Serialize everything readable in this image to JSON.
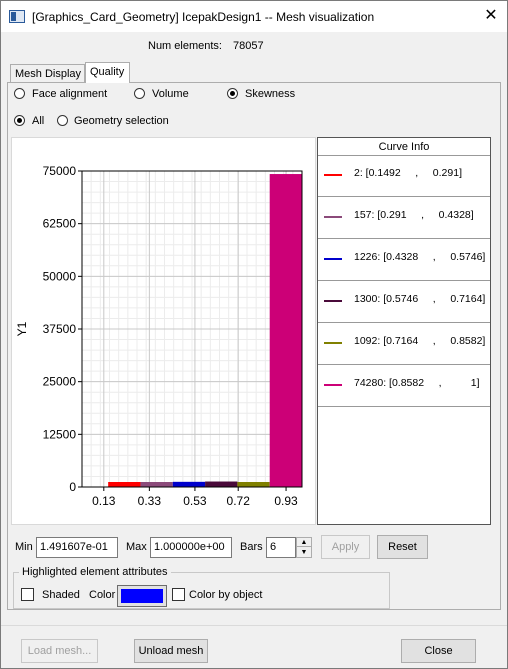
{
  "window": {
    "title": "[Graphics_Card_Geometry] IcepakDesign1 -- Mesh visualization",
    "close_glyph": "✕",
    "app_icon": "window-icon"
  },
  "summary": {
    "num_elements_label": "Num elements:",
    "num_elements_value": "78057"
  },
  "tabs": [
    {
      "label": "Mesh Display",
      "active": false
    },
    {
      "label": "Quality",
      "active": true
    }
  ],
  "metric": {
    "options": [
      "Face alignment",
      "Volume",
      "Skewness"
    ],
    "selected": "Skewness"
  },
  "scope": {
    "options": [
      "All",
      "Geometry selection"
    ],
    "selected": "All"
  },
  "chart_data": {
    "type": "bar",
    "ylabel": "Y1",
    "xlabel": "",
    "x_ticks": [
      "0.13",
      "0.33",
      "0.53",
      "0.72",
      "0.93"
    ],
    "y_ticks": [
      "0",
      "12500",
      "25000",
      "37500",
      "50000",
      "62500",
      "75000"
    ],
    "xlim": [
      0.0343,
      1.0
    ],
    "ylim": [
      0,
      75000
    ],
    "grid": true,
    "bins": [
      {
        "label": "2: [0.1492     ,     0.291]",
        "x0": 0.1492,
        "x1": 0.291,
        "value": 2,
        "color": "#ff0000"
      },
      {
        "label": "157: [0.291     ,     0.4328]",
        "x0": 0.291,
        "x1": 0.4328,
        "value": 157,
        "color": "#8b4a7a"
      },
      {
        "label": "1226: [0.4328     ,     0.5746]",
        "x0": 0.4328,
        "x1": 0.5746,
        "value": 1226,
        "color": "#0000cc"
      },
      {
        "label": "1300: [0.5746     ,     0.7164]",
        "x0": 0.5746,
        "x1": 0.7164,
        "value": 1300,
        "color": "#4a0a3a"
      },
      {
        "label": "1092: [0.7164     ,     0.8582]",
        "x0": 0.7164,
        "x1": 0.8582,
        "value": 1092,
        "color": "#808000"
      },
      {
        "label": "74280: [0.8582     ,          1]",
        "x0": 0.8582,
        "x1": 1.0,
        "value": 74280,
        "color": "#cc0077"
      }
    ]
  },
  "curve_info": {
    "title": "Curve Info"
  },
  "range": {
    "min_label": "Min",
    "min_value": "1.491607e-01",
    "max_label": "Max",
    "max_value": "1.000000e+00",
    "bars_label": "Bars",
    "bars_value": "6"
  },
  "actions": {
    "apply": "Apply",
    "reset": "Reset"
  },
  "highlight": {
    "title": "Highlighted element attributes",
    "shaded_label": "Shaded",
    "color_label": "Color",
    "color_value": "#0000ff",
    "color_by_object_label": "Color by object"
  },
  "footer": {
    "load_mesh": "Load mesh...",
    "unload_mesh": "Unload mesh",
    "close": "Close"
  }
}
